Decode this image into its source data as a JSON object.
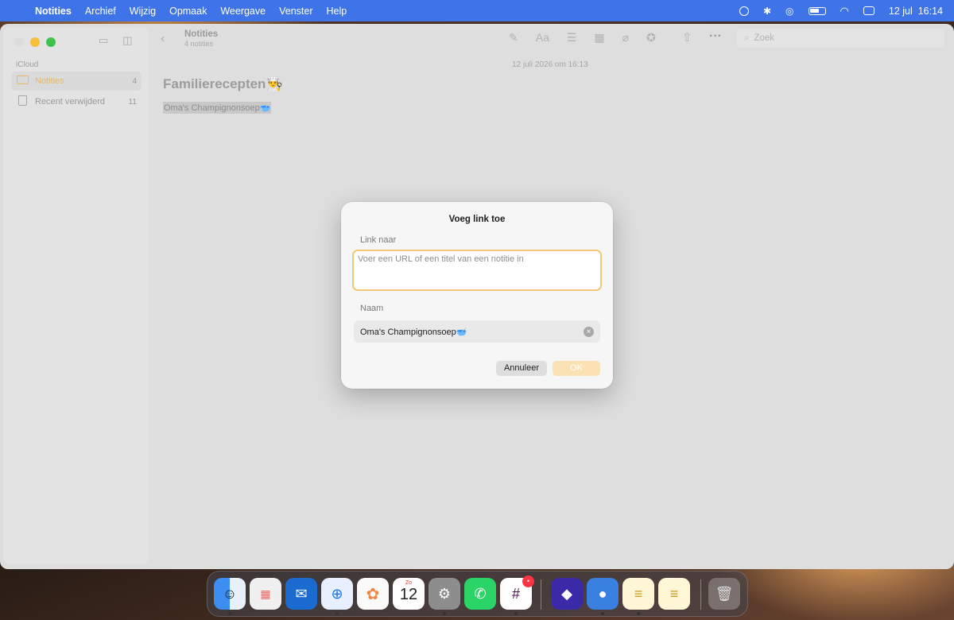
{
  "menubar": {
    "app_name": "Notities",
    "items": [
      "Archief",
      "Wijzig",
      "Opmaak",
      "Weergave",
      "Venster",
      "Help"
    ],
    "date": "12 jul",
    "time": "16:14"
  },
  "sidebar": {
    "section": "iCloud",
    "items": [
      {
        "label": "Notities",
        "count": "4",
        "icon": "folder-icon"
      },
      {
        "label": "Recent verwijderd",
        "count": "11",
        "icon": "trash-icon"
      }
    ]
  },
  "toolbar": {
    "title": "Notities",
    "subtitle": "4 notities",
    "format_glyph": "Aa",
    "search_placeholder": "Zoek"
  },
  "note": {
    "date": "12 juli 2026 om 16:13",
    "title": "Familierecepten👨‍🍳",
    "selected_text": "Oma's Champignonsoep🥣"
  },
  "dialog": {
    "title": "Voeg link toe",
    "link_label": "Link naar",
    "link_placeholder": "Voer een URL of een titel van een notitie in",
    "name_label": "Naam",
    "name_value": "Oma's Champignonsoep🥣",
    "cancel_label": "Annuleer",
    "ok_label": "OK"
  },
  "dock": {
    "calendar_month": "Zo",
    "calendar_day": "12",
    "slack_badge": "•"
  },
  "colors": {
    "menubar": "#3f74e8",
    "accent": "#f2c777",
    "ok_button": "#fbe2b4"
  }
}
